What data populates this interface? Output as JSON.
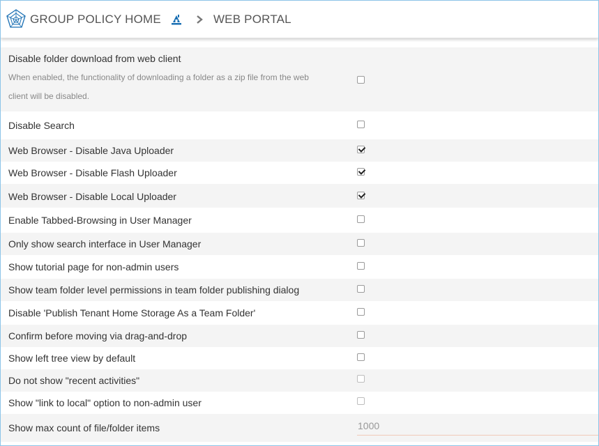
{
  "header": {
    "crumb_home": "GROUP POLICY HOME",
    "crumb_current": "WEB PORTAL"
  },
  "settings": [
    {
      "label": "Disable folder download from web client",
      "description": "When enabled, the functionality of downloading a folder as a zip file from the web client will be disabled.",
      "checked": false
    },
    {
      "label": "Disable Search",
      "checked": false
    },
    {
      "label": "Web Browser - Disable Java Uploader",
      "checked": true
    },
    {
      "label": "Web Browser - Disable Flash Uploader",
      "checked": true
    },
    {
      "label": "Web Browser - Disable Local Uploader",
      "checked": true
    },
    {
      "label": "Enable Tabbed-Browsing in User Manager",
      "checked": false
    },
    {
      "label": "Only show search interface in User Manager",
      "checked": false
    },
    {
      "label": "Show tutorial page for non-admin users",
      "checked": false
    },
    {
      "label": "Show team folder level permissions in team folder publishing dialog",
      "checked": false
    },
    {
      "label": "Disable 'Publish Tenant Home Storage As a Team Folder'",
      "checked": false
    },
    {
      "label": "Confirm before moving via drag-and-drop",
      "checked": false
    },
    {
      "label": "Show left tree view by default",
      "checked": false
    },
    {
      "label": "Do not show \"recent activities\"",
      "checked": false
    },
    {
      "label": "Show \"link to local\" option to non-admin user",
      "checked": false
    },
    {
      "label": "Show max count of file/folder items",
      "value": "1000"
    }
  ],
  "icons": {
    "logo": "network-logo-icon",
    "home": "home-icon",
    "separator": "chevron-right-icon"
  },
  "colors": {
    "frame_border": "#8cc4e8",
    "accent": "#1a6fb3",
    "row_alt": "#f4f4f4"
  }
}
